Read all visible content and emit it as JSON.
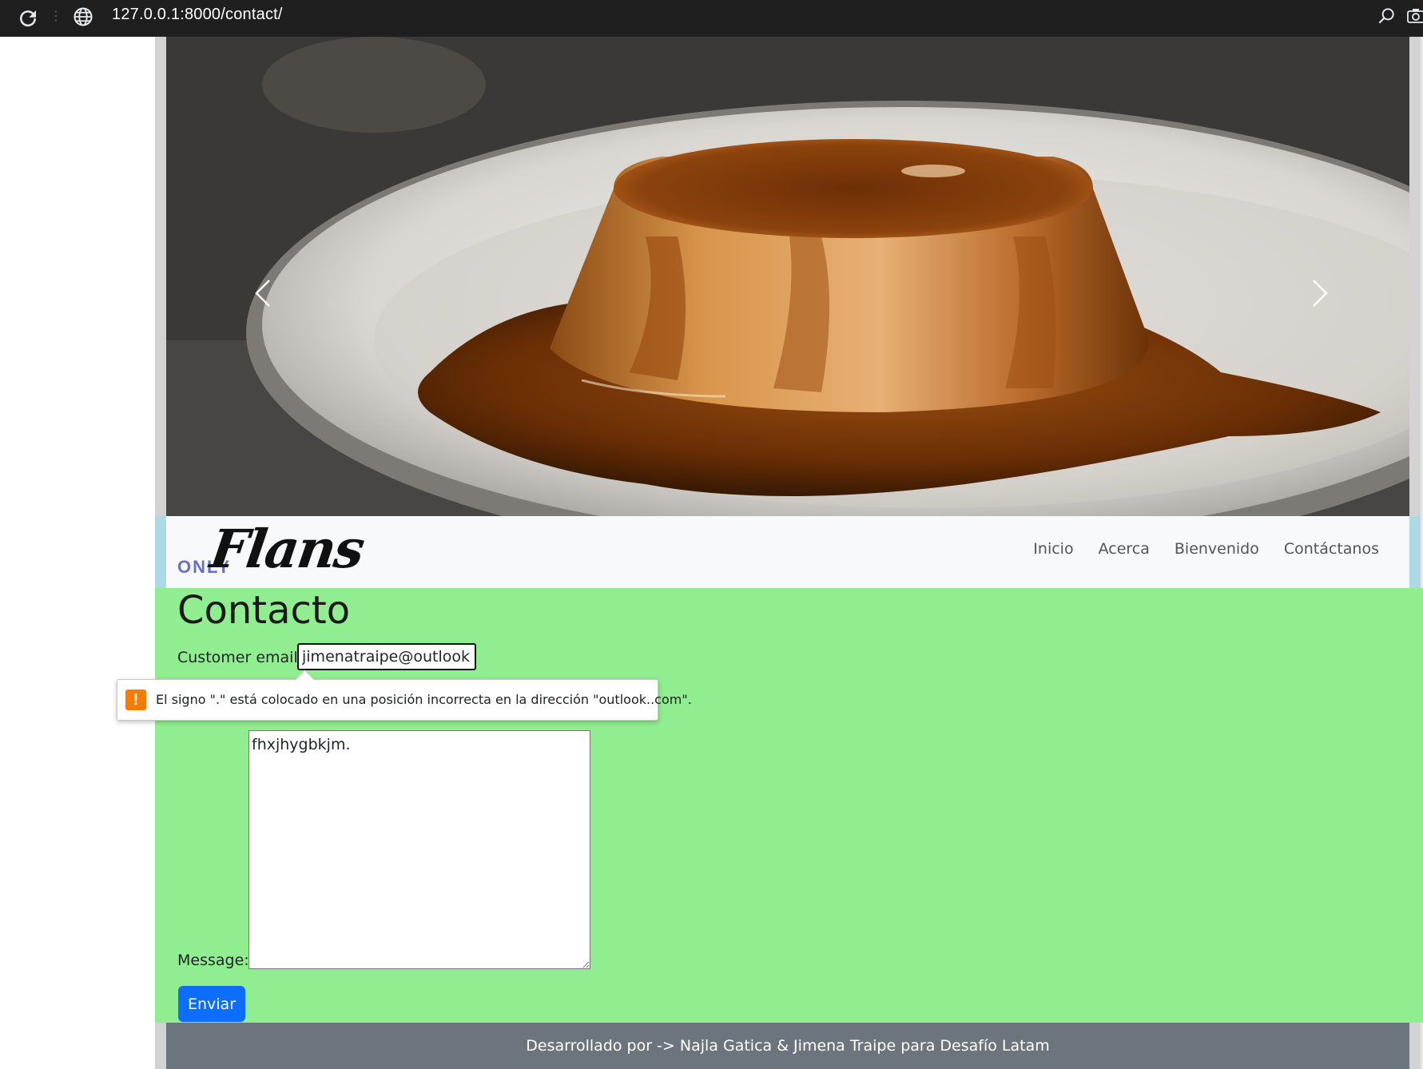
{
  "browser": {
    "url": "127.0.0.1:8000/contact/",
    "icons": [
      "reload-icon",
      "site-info-icon",
      "zoom-icon",
      "screenshot-icon"
    ]
  },
  "carousel": {
    "prev_icon": "chevron-left-icon",
    "next_icon": "chevron-right-icon"
  },
  "navbar": {
    "brand_small": "ONLY",
    "brand_script": "Flans",
    "links": [
      "Inicio",
      "Acerca",
      "Bienvenido",
      "Contáctanos"
    ]
  },
  "contact": {
    "title": "Contacto",
    "email_label": "Customer email:",
    "email_value": "jimenatraipe@outlook..com",
    "message_label": "Message:",
    "message_value": "fhxjhygbkjm.",
    "submit_label": "Enviar"
  },
  "validation": {
    "icon": "warning-icon",
    "message": "El signo \".\" está colocado en una posición incorrecta en la dirección \"outlook..com\"."
  },
  "footer": {
    "credit": "Desarrollado por -> Najla Gatica & Jimena Traipe para Desafío Latam"
  },
  "colors": {
    "main_bg": "#90ee90",
    "navbar_bg": "#f8f9fa",
    "navbar_edge": "#add8e6",
    "footer_bg": "#6c757d",
    "button_bg": "#0d6efd",
    "warning": "#f57c00",
    "brand_accent": "#6a6fc2"
  }
}
